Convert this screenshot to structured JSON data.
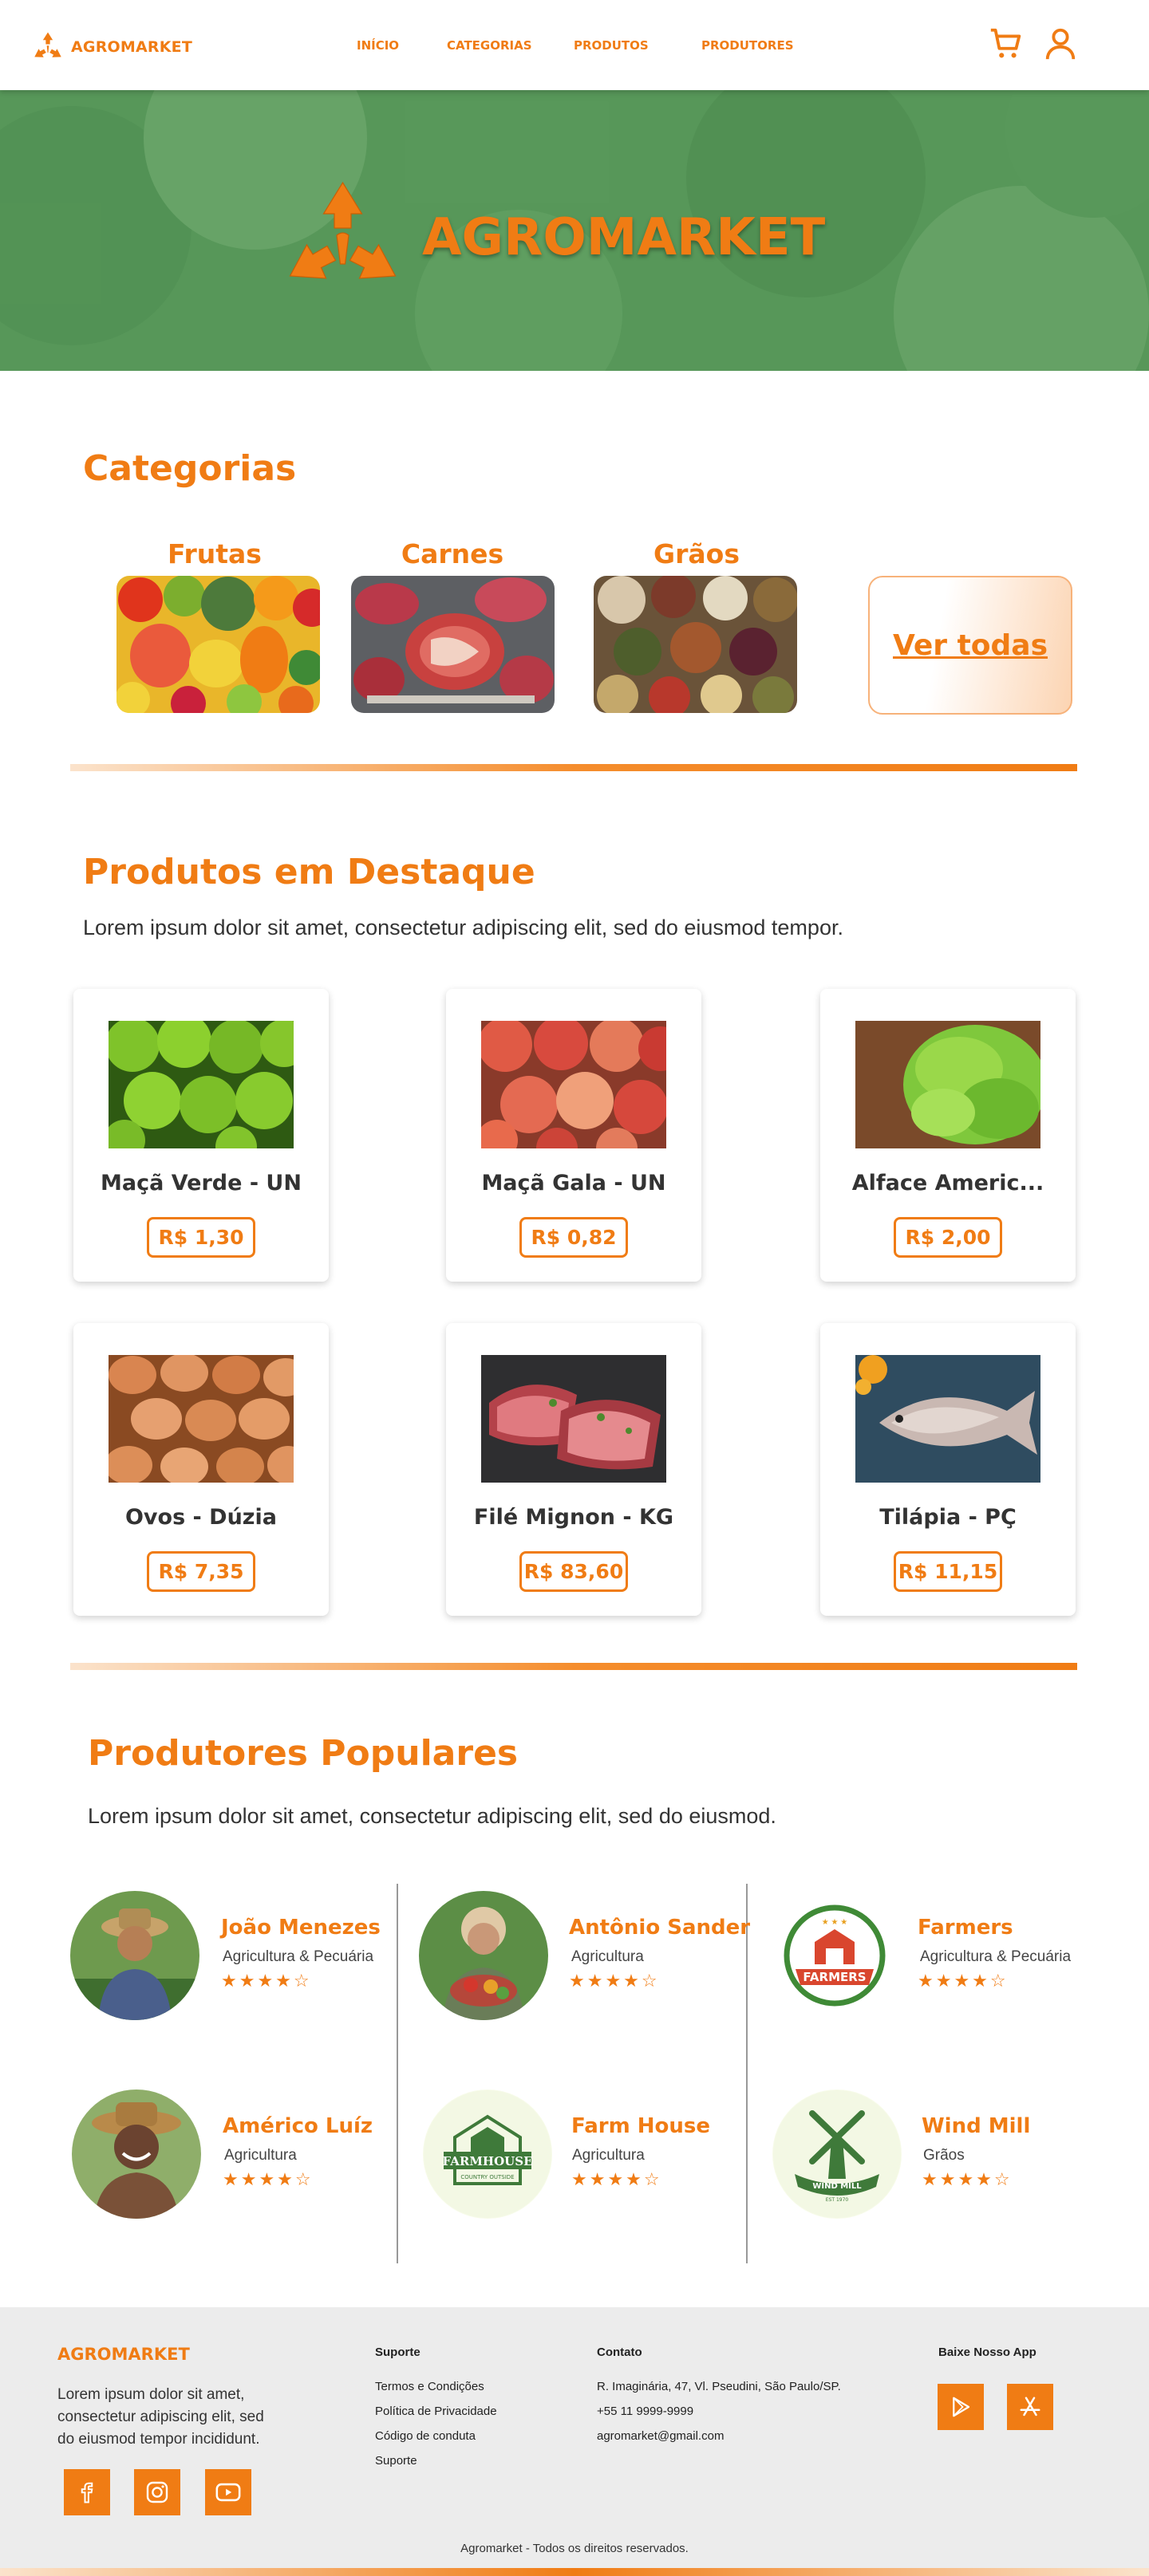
{
  "nav": {
    "brand": "AGROMARKET",
    "links": [
      "INÍCIO",
      "CATEGORIAS",
      "PRODUTOS",
      "PRODUTORES"
    ],
    "icons": [
      "cart-icon",
      "user-icon"
    ]
  },
  "hero": {
    "brand": "AGROMARKET"
  },
  "categories": {
    "title": "Categorias",
    "items": [
      {
        "label": "Frutas"
      },
      {
        "label": "Carnes"
      },
      {
        "label": "Grãos"
      }
    ],
    "see_all": "Ver todas"
  },
  "featured": {
    "title": "Produtos em Destaque",
    "subtitle": "Lorem ipsum dolor sit amet, consectetur adipiscing elit, sed do eiusmod tempor.",
    "products": [
      {
        "name": "Maçã Verde - UN",
        "price": "R$ 1,30"
      },
      {
        "name": "Maçã Gala - UN",
        "price": "R$ 0,82"
      },
      {
        "name": "Alface Americ...",
        "price": "R$ 2,00"
      },
      {
        "name": "Ovos - Dúzia",
        "price": "R$ 7,35"
      },
      {
        "name": "Filé Mignon - KG",
        "price": "R$ 83,60"
      },
      {
        "name": "Tilápia - PÇ",
        "price": "R$ 11,15"
      }
    ]
  },
  "producers": {
    "title": "Produtores Populares",
    "subtitle": "Lorem ipsum dolor sit amet, consectetur adipiscing elit, sed do eiusmod.",
    "items": [
      {
        "name": "João Menezes",
        "category": "Agricultura & Pecuária",
        "rating": 4
      },
      {
        "name": "Antônio Sander",
        "category": "Agricultura",
        "rating": 4
      },
      {
        "name": "Farmers",
        "category": "Agricultura & Pecuária",
        "rating": 4,
        "logo_text": "FARMERS"
      },
      {
        "name": "Américo Luíz",
        "category": "Agricultura",
        "rating": 4
      },
      {
        "name": "Farm House",
        "category": "Agricultura",
        "rating": 4,
        "logo_text": "FARMHOUSE",
        "logo_sub": "COUNTRY OUTSIDE"
      },
      {
        "name": "Wind Mill",
        "category": "Grãos",
        "rating": 4,
        "logo_text": "WIND MILL",
        "logo_sub": "EST 1970"
      }
    ]
  },
  "footer": {
    "brand": "AGROMARKET",
    "about_lines": [
      "Lorem ipsum dolor sit amet,",
      "consectetur adipiscing elit, sed",
      "do eiusmod tempor incididunt."
    ],
    "support_title": "Suporte",
    "support_links": [
      "Termos e Condições",
      "Política de Privacidade",
      "Código de conduta",
      "Suporte"
    ],
    "contact_title": "Contato",
    "contact_lines": [
      "R. Imaginária, 47, Vl. Pseudini, São Paulo/SP.",
      "+55 11 9999-9999",
      "agromarket@gmail.com"
    ],
    "app_title": "Baixe Nosso App",
    "social_icons": [
      "facebook-icon",
      "instagram-icon",
      "youtube-icon"
    ],
    "store_icons": [
      "play-store-icon",
      "app-store-icon"
    ],
    "copyright": "Agromarket - Todos os direitos reservados."
  },
  "colors": {
    "accent": "#f07c14",
    "hero_green": "#5a9a5c",
    "footer_bg": "#ececec"
  }
}
